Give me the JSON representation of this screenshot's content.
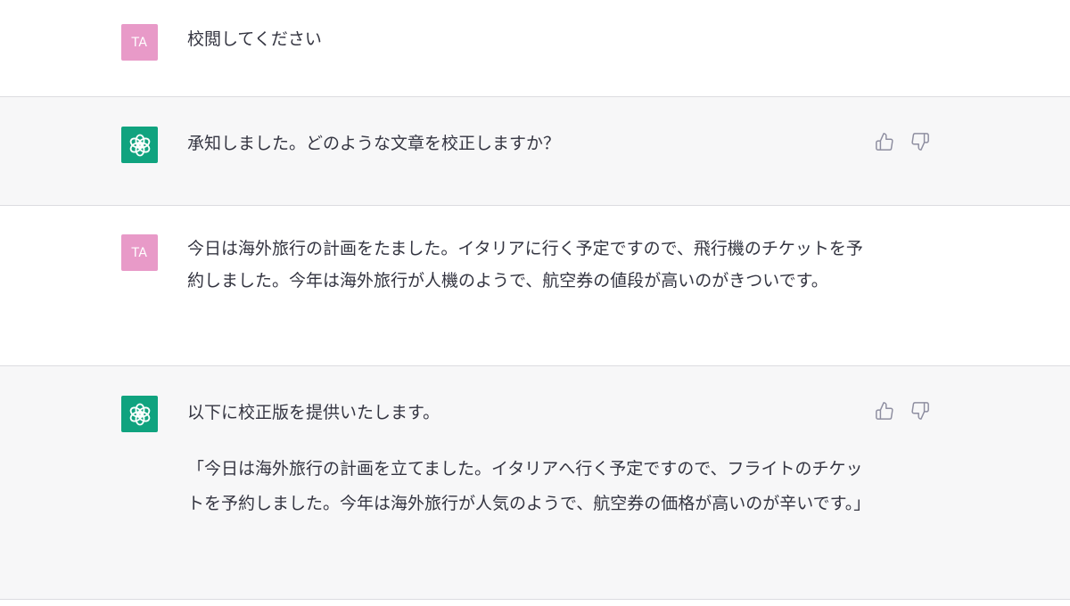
{
  "messages": [
    {
      "role": "user",
      "avatar_label": "TA",
      "text": "校閲してください"
    },
    {
      "role": "assistant",
      "text": "承知しました。どのような文章を校正しますか？"
    },
    {
      "role": "user",
      "avatar_label": "TA",
      "text": "今日は海外旅行の計画をたました。イタリアに行く予定ですので、飛行機のチケットを予約しました。今年は海外旅行が人機のようで、航空券の値段が高いのがきついです。"
    },
    {
      "role": "assistant",
      "text": "以下に校正版を提供いたします。",
      "quote": "「今日は海外旅行の計画を立てました。イタリアへ行く予定ですので、フライトのチケットを予約しました。今年は海外旅行が人気のようで、航空券の価格が高いのが辛いです。」"
    }
  ],
  "icons": {
    "assistant_avatar": "openai-logo-icon",
    "thumbs_up": "thumbs-up-icon",
    "thumbs_down": "thumbs-down-icon"
  },
  "colors": {
    "user_avatar_bg": "#e89ac8",
    "assistant_avatar_bg": "#10a37f",
    "assistant_row_bg": "#f7f7f8"
  }
}
